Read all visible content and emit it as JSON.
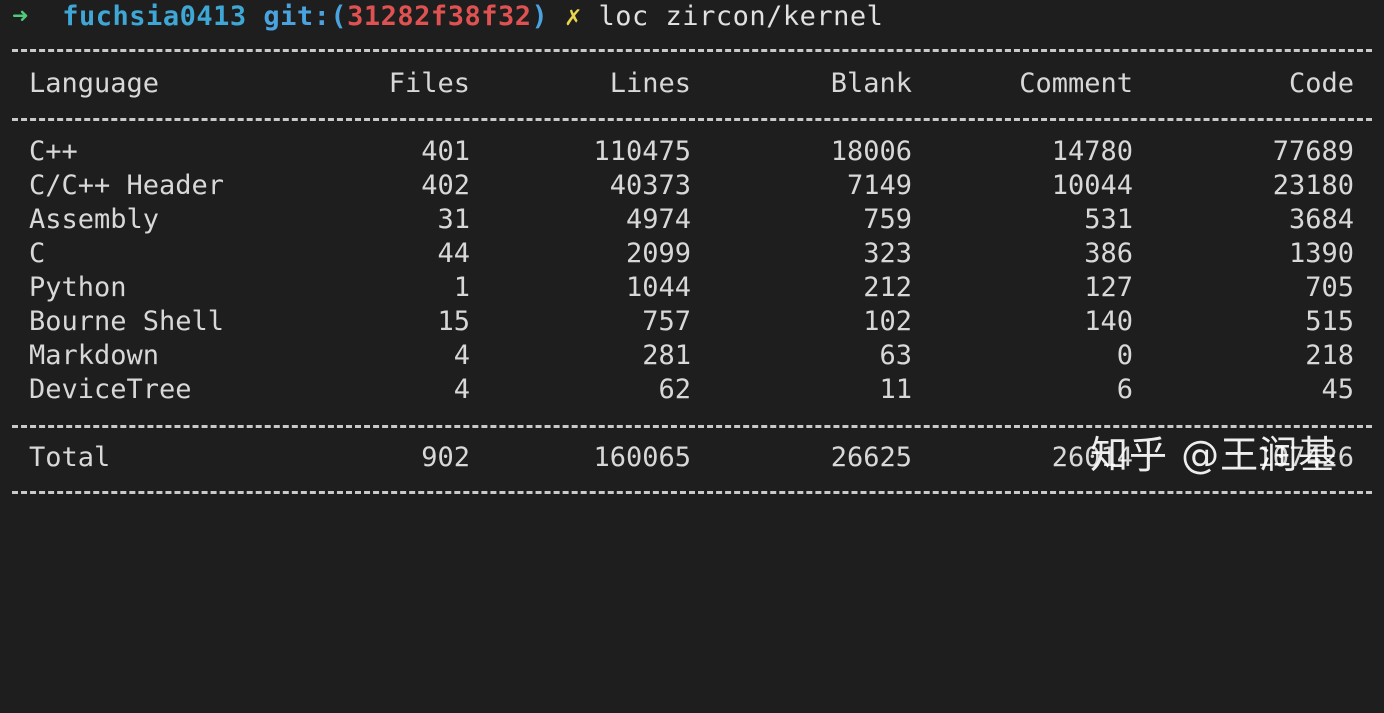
{
  "prompt": {
    "arrow": "➜",
    "directory": "fuchsia0413",
    "git_label": "git:",
    "paren_open": "(",
    "commit": "31282f38f32",
    "paren_close": ")",
    "dirty_mark": "✗",
    "command": "loc zircon/kernel"
  },
  "table": {
    "headers": {
      "language": "Language",
      "files": "Files",
      "lines": "Lines",
      "blank": "Blank",
      "comment": "Comment",
      "code": "Code"
    },
    "rows": [
      {
        "language": "C++",
        "files": "401",
        "lines": "110475",
        "blank": "18006",
        "comment": "14780",
        "code": "77689"
      },
      {
        "language": "C/C++ Header",
        "files": "402",
        "lines": "40373",
        "blank": "7149",
        "comment": "10044",
        "code": "23180"
      },
      {
        "language": "Assembly",
        "files": "31",
        "lines": "4974",
        "blank": "759",
        "comment": "531",
        "code": "3684"
      },
      {
        "language": "C",
        "files": "44",
        "lines": "2099",
        "blank": "323",
        "comment": "386",
        "code": "1390"
      },
      {
        "language": "Python",
        "files": "1",
        "lines": "1044",
        "blank": "212",
        "comment": "127",
        "code": "705"
      },
      {
        "language": "Bourne Shell",
        "files": "15",
        "lines": "757",
        "blank": "102",
        "comment": "140",
        "code": "515"
      },
      {
        "language": "Markdown",
        "files": "4",
        "lines": "281",
        "blank": "63",
        "comment": "0",
        "code": "218"
      },
      {
        "language": "DeviceTree",
        "files": "4",
        "lines": "62",
        "blank": "11",
        "comment": "6",
        "code": "45"
      }
    ],
    "total": {
      "language": "Total",
      "files": "902",
      "lines": "160065",
      "blank": "26625",
      "comment": "26014",
      "code": "107426"
    }
  },
  "watermark": "知乎 @王润基",
  "colors": {
    "background": "#1e1e1e",
    "text": "#d8d8d8",
    "arrow": "#4ec97a",
    "directory": "#3fa7d6",
    "git": "#4aa3df",
    "commit": "#e05252",
    "dirty": "#e8d44d"
  }
}
